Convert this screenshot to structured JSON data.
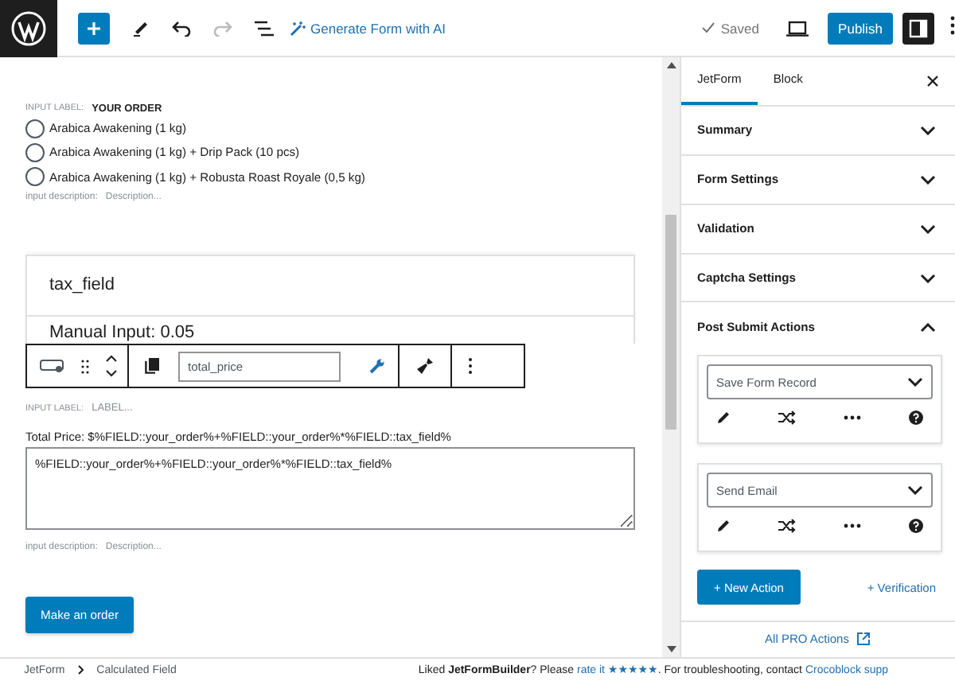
{
  "toolbar": {
    "ai_button": "Generate Form with AI",
    "save_status": "Saved",
    "publish": "Publish"
  },
  "form": {
    "radio_field": {
      "label_prefix": "INPUT LABEL:",
      "label": "YOUR ORDER",
      "options": [
        {
          "label": "Arabica Awakening (1 kg)",
          "selected": false
        },
        {
          "label": "Arabica Awakening (1 kg) + Drip Pack (10 pcs)",
          "selected": false
        },
        {
          "label": "Arabica Awakening (1 kg) + Robusta Roast Royale (0,5 kg)",
          "selected": false
        }
      ],
      "description_prefix": "input description:",
      "description": "Description..."
    },
    "tax_card": {
      "title": "tax_field",
      "value": "Manual Input: 0.05"
    },
    "block_toolbar": {
      "name_value": "total_price"
    },
    "calc_field": {
      "label_prefix": "INPUT LABEL:",
      "label": "LABEL...",
      "formula_label": "Total Price: $%FIELD::your_order%+%FIELD::your_order%*%FIELD::tax_field%",
      "formula": "%FIELD::your_order%+%FIELD::your_order%*%FIELD::tax_field%",
      "description_prefix": "input description:",
      "description": "Description..."
    },
    "submit": "Make an order"
  },
  "sidebar": {
    "tabs": [
      {
        "label": "JetForm",
        "selected": true
      },
      {
        "label": "Block",
        "selected": false
      }
    ],
    "panels": [
      {
        "title": "Summary",
        "expanded": false
      },
      {
        "title": "Form Settings",
        "expanded": false
      },
      {
        "title": "Validation",
        "expanded": false
      },
      {
        "title": "Captcha Settings",
        "expanded": false
      },
      {
        "title": "Post Submit Actions",
        "expanded": true
      }
    ],
    "actions": [
      {
        "type": "Save Form Record"
      },
      {
        "type": "Send Email"
      }
    ],
    "new_action": "+ New Action",
    "verification": "+ Verification",
    "pro_link": "All PRO Actions"
  },
  "breadcrumb": [
    "JetForm",
    "Calculated Field"
  ],
  "footer_note": {
    "before": "Liked **JetFormBuilder**? Please ",
    "rate_link": "rate it ★★★★★",
    "middle": ". For troubleshooting, contact ",
    "support_link": "Crocoblock supp"
  }
}
